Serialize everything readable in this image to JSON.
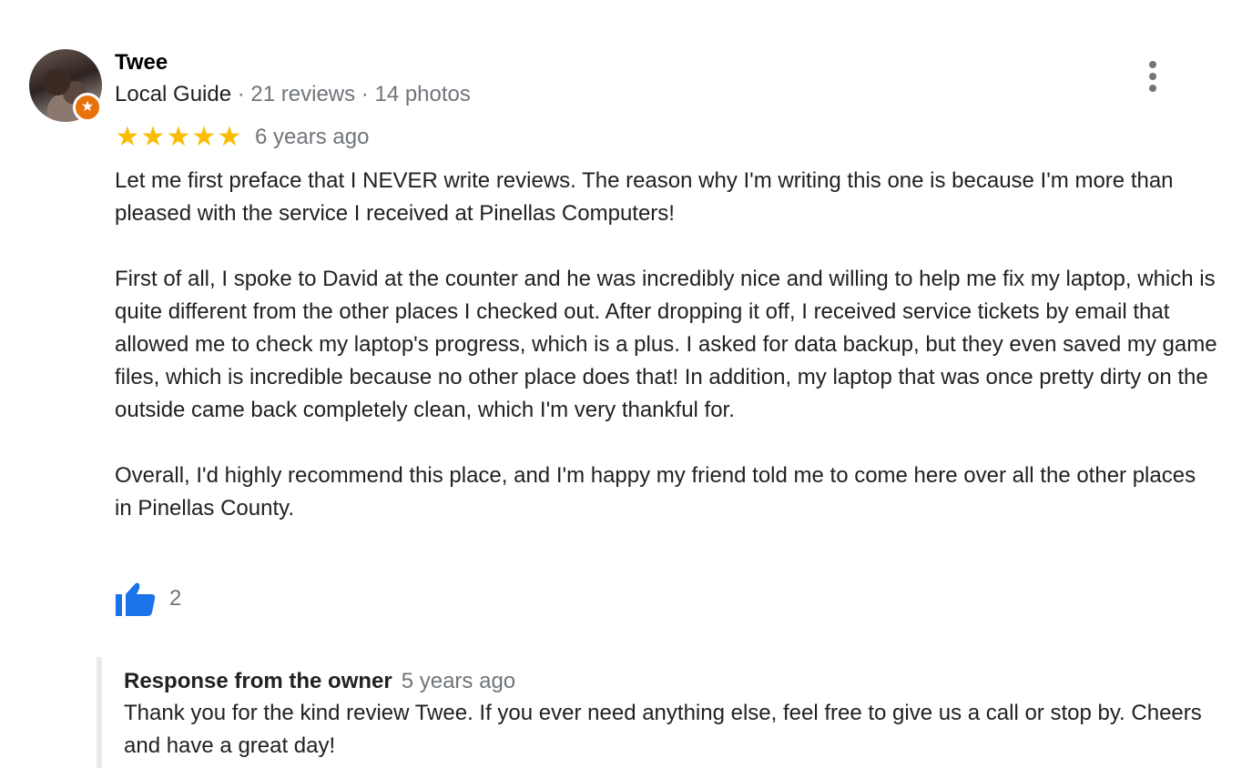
{
  "reviewer": {
    "name": "Twee",
    "level": "Local Guide",
    "reviews": "21 reviews",
    "photos": "14 photos",
    "separator": " · "
  },
  "rating": {
    "stars": 5,
    "star_glyph": "★",
    "date": "6 years ago"
  },
  "review": {
    "paragraphs": [
      "Let me first preface that I NEVER write reviews. The reason why I'm writing this one is because I'm more than pleased with the service I received at Pinellas Computers!",
      "First of all, I spoke to David at the counter and he was incredibly nice and willing to help me fix my laptop, which is quite different from the other places I checked out. After dropping it off, I received service tickets by email that allowed me to check my laptop's progress, which is a plus. I asked for data backup, but they even saved my game files, which is incredible because no other place does that! In addition, my laptop that was once pretty dirty on the outside came back completely clean, which I'm very thankful for.",
      "Overall, I'd highly recommend this place, and I'm happy my friend told me to come here over all the other places in Pinellas County."
    ]
  },
  "likes": {
    "count": "2",
    "icon": "thumbs-up-icon"
  },
  "owner_response": {
    "title": "Response from the owner",
    "date": "5 years ago",
    "text": "Thank you for the kind review Twee. If you ever need anything else, feel free to give us a call or stop by. Cheers and have a great day!"
  },
  "colors": {
    "star": "#fbbc04",
    "like": "#1a73e8",
    "badge": "#e8710a",
    "muted": "#70757a"
  }
}
